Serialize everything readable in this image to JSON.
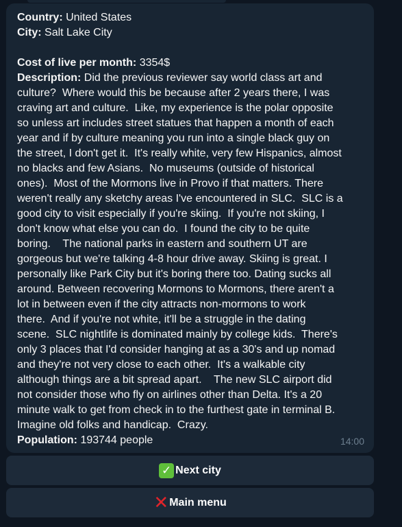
{
  "message": {
    "country_label": "Country:",
    "country_value": "United States",
    "city_label": "City:",
    "city_value": "Salt Lake City",
    "cost_label": "Cost of live per month:",
    "cost_value": "3354$",
    "description_label": "Description:",
    "description_lines": [
      " Did the previous reviewer say world class art and",
      "culture?  Where would this be because after 2 years there, I was",
      "craving art and culture.  Like, my experience is the polar opposite",
      "so unless art includes street statues that happen a month of each",
      "year and if by culture meaning you run into a single black guy on",
      "the street, I don't get it.  It's really white, very few Hispanics, almost",
      "no blacks and few Asians.  No museums (outside of historical",
      "ones).  Most of the Mormons live in Provo if that matters. There",
      "weren't really any sketchy areas I've encountered in SLC.  SLC is a",
      "good city to visit especially if you're skiing.  If you're not skiing, I",
      "don't know what else you can do.  I found the city to be quite",
      "boring.    The national parks in eastern and southern UT are",
      "gorgeous but we're talking 4-8 hour drive away. Skiing is great. I",
      "personally like Park City but it's boring there too. Dating sucks all",
      "around. Between recovering Mormons to Mormons, there aren't a",
      "lot in between even if the city attracts non-mormons to work",
      "there.  And if you're not white, it'll be a struggle in the dating",
      "scene.  SLC nightlife is dominated mainly by college kids.  There's",
      "only 3 places that I'd consider hanging at as a 30's and up nomad",
      "and they're not very close to each other.  It's a walkable city",
      "although things are a bit spread apart.    The new SLC airport did",
      "not consider those who fly on airlines other than Delta. It's a 20",
      "minute walk to get from check in to the furthest gate in terminal B.",
      "Imagine old folks and handicap.  Crazy."
    ],
    "population_label": "Population:",
    "population_value": "193744 people",
    "time": "14:00"
  },
  "keyboard": {
    "next_icon": "check-mark-emoji",
    "next_label": "Next city",
    "menu_icon": "cross-mark-emoji",
    "menu_label": "Main menu"
  },
  "colors": {
    "background": "#0e1621",
    "bubble": "#182533",
    "button": "#1d2a39",
    "text": "#f5f5f5",
    "time": "#6d7f8f"
  }
}
